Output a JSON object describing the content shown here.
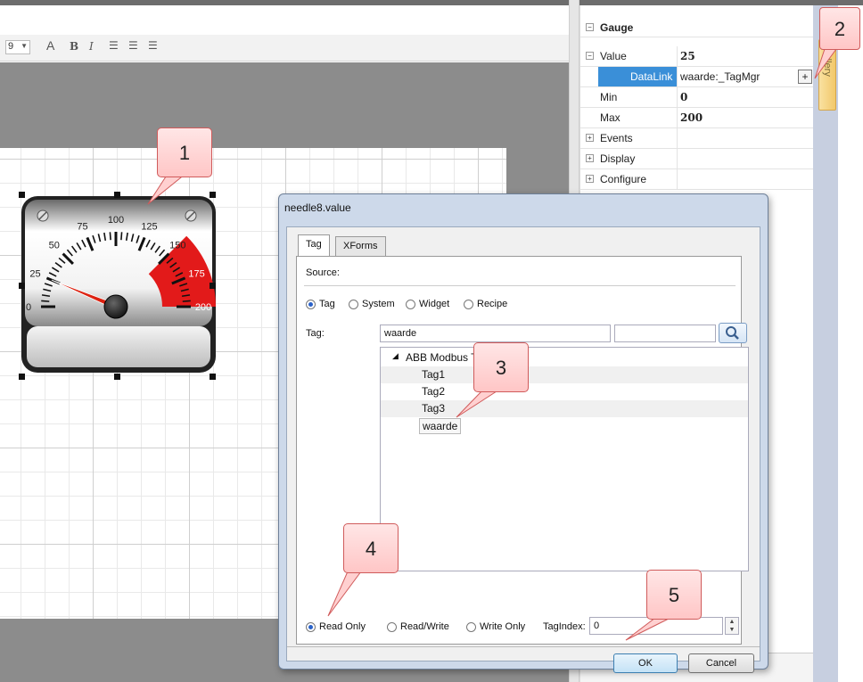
{
  "toolbar": {
    "font_size_value": "9",
    "font_icon": "font-color-icon",
    "bold": "B",
    "italic": "I"
  },
  "properties": {
    "section_gauge": "Gauge",
    "rows": [
      {
        "key": "Value",
        "value": "25"
      },
      {
        "key": "DataLink",
        "value": "waarde:_TagMgr",
        "button": "+"
      },
      {
        "key": "Min",
        "value": "0"
      },
      {
        "key": "Max",
        "value": "200"
      },
      {
        "key": "Events",
        "value": ""
      },
      {
        "key": "Display",
        "value": ""
      },
      {
        "key": "Configure",
        "value": ""
      }
    ]
  },
  "gallery_tab": "Gallery",
  "gauge": {
    "ticks": [
      "0",
      "25",
      "50",
      "75",
      "100",
      "125",
      "150",
      "175",
      "200"
    ],
    "value": 25,
    "min": 0,
    "max": 200,
    "red_zone_start": 150,
    "red_color": "#e21a1a"
  },
  "dialog": {
    "title": "needle8.value",
    "tabs": [
      "Tag",
      "XForms"
    ],
    "source_label": "Source:",
    "source_options": [
      "Tag",
      "System",
      "Widget",
      "Recipe"
    ],
    "tag_label": "Tag:",
    "tag_value": "waarde",
    "tree_root": "ABB Modbus TC",
    "tree_items": [
      "Tag1",
      "Tag2",
      "Tag3",
      "waarde"
    ],
    "access_options": [
      "Read Only",
      "Read/Write",
      "Write Only"
    ],
    "tagindex_label": "TagIndex:",
    "tagindex_value": "0",
    "ok": "OK",
    "cancel": "Cancel"
  },
  "callouts": [
    "1",
    "2",
    "3",
    "4",
    "5"
  ]
}
